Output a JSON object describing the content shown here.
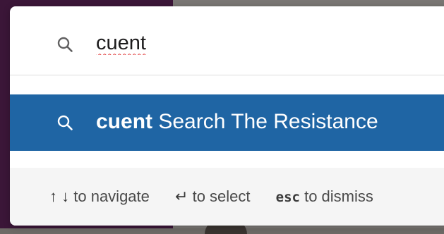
{
  "search": {
    "query": "cuent",
    "icon": "search-icon"
  },
  "result": {
    "query": "cuent",
    "label": "Search The Resistance",
    "icon": "search-icon",
    "highlight_color": "#1f65a4"
  },
  "footer": {
    "navigate_keys": "↑ ↓",
    "navigate_label": "to navigate",
    "select_key": "↵",
    "select_label": "to select",
    "dismiss_key": "esc",
    "dismiss_label": "to dismiss"
  }
}
